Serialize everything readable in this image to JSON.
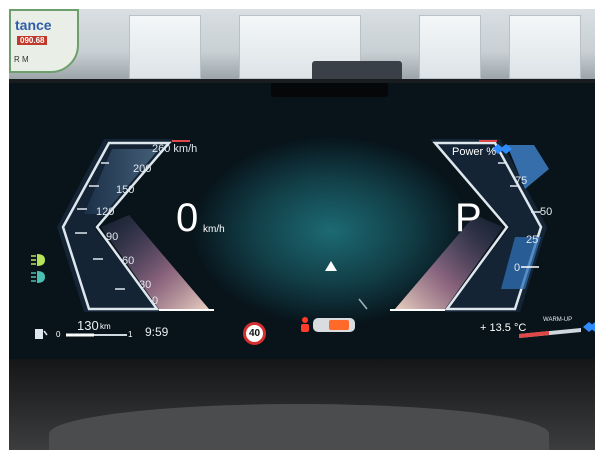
{
  "sticker": {
    "text": "tance",
    "number": "090.68",
    "sub": "R M"
  },
  "speedometer": {
    "scale_unit_label": "260 km/h",
    "ticks": [
      "200",
      "150",
      "120",
      "90",
      "60",
      "30",
      "0"
    ],
    "speed_value": "0",
    "speed_unit": "km/h"
  },
  "power_meter": {
    "label": "Power %",
    "ticks": [
      "75",
      "50",
      "25",
      "0"
    ],
    "gear": "P"
  },
  "bottom": {
    "range_value": "130",
    "range_unit": "km",
    "fuel_scale_min": "0",
    "fuel_scale_max": "1",
    "clock": "9:59",
    "speed_limit": "40",
    "outside_temp": "+ 13.5 °C",
    "warmup_label": "WARM-UP"
  },
  "icons": {
    "headlight": "headlight-icon",
    "auto_highbeam": "auto-high-beam-icon",
    "fuel": "fuel-pump-icon",
    "navigation": "navigation-arrow-icon",
    "driver_assist": "driver-assist-car-icon",
    "brand": "bmw-efficient-icon"
  },
  "colors": {
    "display_glow": "#1c6a73",
    "gauge_outline": "#dfe7ee",
    "speed_limit_ring": "#d32f2f",
    "assist_orange": "#ff6a2a",
    "indicator_green": "#b7e35a",
    "accent_blue": "#2f8cff"
  }
}
